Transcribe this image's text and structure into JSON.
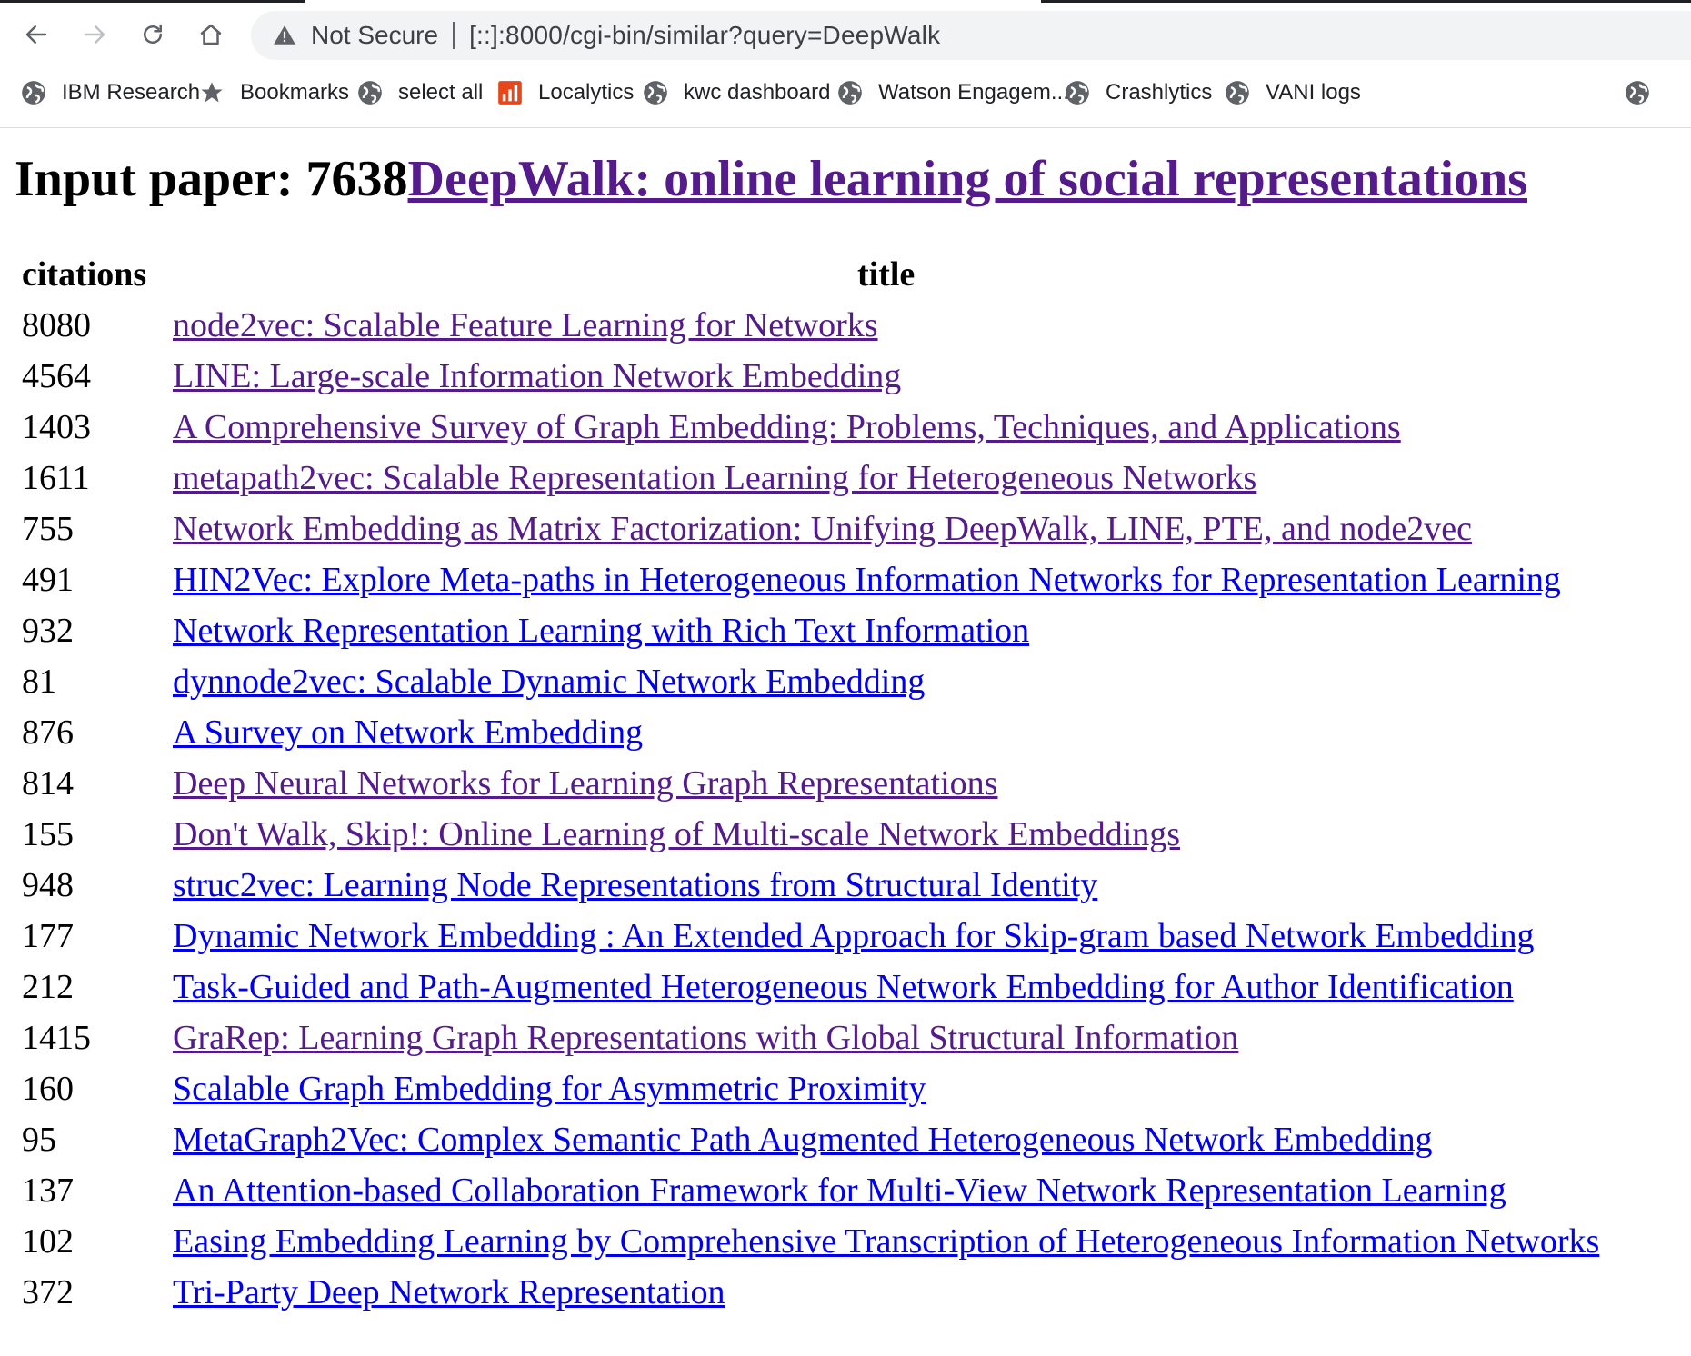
{
  "browser": {
    "security_label": "Not Secure",
    "url": "[::]:8000/cgi-bin/similar?query=DeepWalk",
    "bookmarks": [
      {
        "label": "IBM Research",
        "icon": "globe-icon"
      },
      {
        "label": "Bookmarks",
        "icon": "star-icon"
      },
      {
        "label": "select all",
        "icon": "globe-icon"
      },
      {
        "label": "Localytics",
        "icon": "bar-chart-icon"
      },
      {
        "label": "kwc dashboard",
        "icon": "globe-icon"
      },
      {
        "label": "Watson Engagem...",
        "icon": "globe-icon"
      },
      {
        "label": "Crashlytics",
        "icon": "globe-icon"
      },
      {
        "label": "VANI logs",
        "icon": "globe-icon"
      },
      {
        "label": "",
        "icon": "globe-icon"
      }
    ],
    "colors": {
      "localytics_icon": "#e8471c",
      "omnibox_bg": "#f1f3f4"
    }
  },
  "page": {
    "heading_prefix": "Input paper: 7638",
    "heading_link": "DeepWalk: online learning of social representations",
    "table": {
      "headers": {
        "citations": "citations",
        "title": "title"
      },
      "rows": [
        {
          "citations": "8080",
          "title": "node2vec: Scalable Feature Learning for Networks",
          "visited": true
        },
        {
          "citations": "4564",
          "title": "LINE: Large-scale Information Network Embedding",
          "visited": true
        },
        {
          "citations": "1403",
          "title": "A Comprehensive Survey of Graph Embedding: Problems, Techniques, and Applications",
          "visited": true
        },
        {
          "citations": "1611",
          "title": "metapath2vec: Scalable Representation Learning for Heterogeneous Networks",
          "visited": true
        },
        {
          "citations": "755",
          "title": "Network Embedding as Matrix Factorization: Unifying DeepWalk, LINE, PTE, and node2vec",
          "visited": true
        },
        {
          "citations": "491",
          "title": "HIN2Vec: Explore Meta-paths in Heterogeneous Information Networks for Representation Learning",
          "visited": false
        },
        {
          "citations": "932",
          "title": "Network Representation Learning with Rich Text Information",
          "visited": false
        },
        {
          "citations": "81",
          "title": "dynnode2vec: Scalable Dynamic Network Embedding",
          "visited": false
        },
        {
          "citations": "876",
          "title": "A Survey on Network Embedding",
          "visited": false
        },
        {
          "citations": "814",
          "title": "Deep Neural Networks for Learning Graph Representations",
          "visited": true
        },
        {
          "citations": "155",
          "title": "Don't Walk, Skip!: Online Learning of Multi-scale Network Embeddings",
          "visited": true
        },
        {
          "citations": "948",
          "title": "struc2vec: Learning Node Representations from Structural Identity",
          "visited": false
        },
        {
          "citations": "177",
          "title": "Dynamic Network Embedding : An Extended Approach for Skip-gram based Network Embedding",
          "visited": false
        },
        {
          "citations": "212",
          "title": "Task-Guided and Path-Augmented Heterogeneous Network Embedding for Author Identification",
          "visited": false
        },
        {
          "citations": "1415",
          "title": "GraRep: Learning Graph Representations with Global Structural Information",
          "visited": true
        },
        {
          "citations": "160",
          "title": "Scalable Graph Embedding for Asymmetric Proximity",
          "visited": false
        },
        {
          "citations": "95",
          "title": "MetaGraph2Vec: Complex Semantic Path Augmented Heterogeneous Network Embedding",
          "visited": false
        },
        {
          "citations": "137",
          "title": "An Attention-based Collaboration Framework for Multi-View Network Representation Learning",
          "visited": false
        },
        {
          "citations": "102",
          "title": "Easing Embedding Learning by Comprehensive Transcription of Heterogeneous Information Networks",
          "visited": false
        },
        {
          "citations": "372",
          "title": "Tri-Party Deep Network Representation",
          "visited": false
        }
      ]
    },
    "colors": {
      "visited_link": "#551a8b",
      "unvisited_link": "#0000ee"
    }
  }
}
